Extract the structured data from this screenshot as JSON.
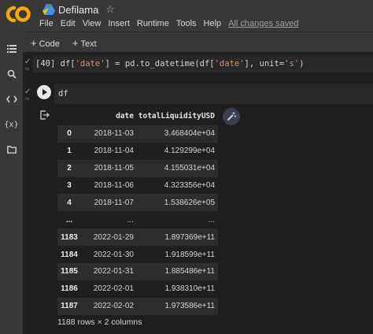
{
  "header": {
    "doc_title": "Defilama",
    "menu": [
      "File",
      "Edit",
      "View",
      "Insert",
      "Runtime",
      "Tools",
      "Help"
    ],
    "saved_status": "All changes saved"
  },
  "toolbar": {
    "code_label": "Code",
    "text_label": "Text"
  },
  "sidebar": {
    "icons": [
      "toc-icon",
      "search-icon",
      "code-snippets-icon",
      "variables-icon",
      "files-icon"
    ],
    "variables_glyph": "{x}"
  },
  "cells": {
    "cell1": {
      "prompt": "[40]",
      "tokens": [
        "df[",
        "'date'",
        "] = pd.to_datetime(df[",
        "'date'",
        "], unit=",
        "'s'",
        ")"
      ],
      "exec_time": "0s"
    },
    "cell2": {
      "code": "df",
      "exec_time": "0s"
    }
  },
  "output": {
    "columns": [
      "",
      "date",
      "totalLiquidityUSD"
    ],
    "rows": [
      {
        "index": "0",
        "date": "2018-11-03",
        "liq": "3.468404e+04"
      },
      {
        "index": "1",
        "date": "2018-11-04",
        "liq": "4.129299e+04"
      },
      {
        "index": "2",
        "date": "2018-11-05",
        "liq": "4.155031e+04"
      },
      {
        "index": "3",
        "date": "2018-11-06",
        "liq": "4.323356e+04"
      },
      {
        "index": "4",
        "date": "2018-11-07",
        "liq": "1.538626e+05"
      },
      {
        "index": "...",
        "date": "...",
        "liq": "..."
      },
      {
        "index": "1183",
        "date": "2022-01-29",
        "liq": "1.897369e+11"
      },
      {
        "index": "1184",
        "date": "2022-01-30",
        "liq": "1.918599e+11"
      },
      {
        "index": "1185",
        "date": "2022-01-31",
        "liq": "1.885486e+11"
      },
      {
        "index": "1186",
        "date": "2022-02-01",
        "liq": "1.938310e+11"
      },
      {
        "index": "1187",
        "date": "2022-02-02",
        "liq": "1.973586e+11"
      }
    ],
    "shape_text": "1188 rows × 2 columns"
  },
  "colors": {
    "chrome": "#383838",
    "background": "#1e1e1e",
    "logo_orange": "#f9ab00",
    "string_color": "#ce9178"
  }
}
